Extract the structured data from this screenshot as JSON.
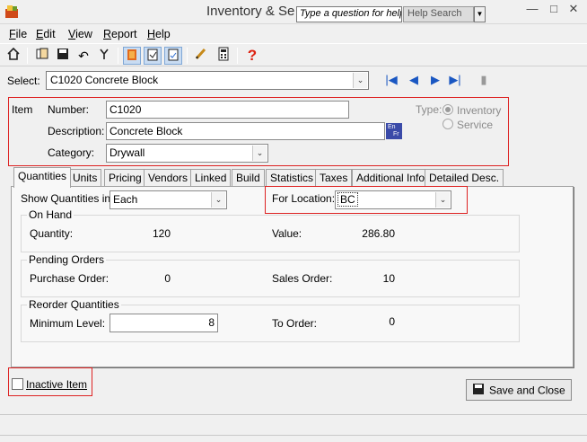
{
  "window": {
    "title": "Inventory & Se",
    "help_placeholder": "Type a question for help",
    "help_search_label": "Help Search"
  },
  "menu": [
    {
      "underline": "F",
      "rest": "ile"
    },
    {
      "underline": "E",
      "rest": "dit"
    },
    {
      "underline": "V",
      "rest": "iew"
    },
    {
      "underline": "R",
      "rest": "eport"
    },
    {
      "underline": "H",
      "rest": "elp"
    }
  ],
  "select": {
    "label": "Select:",
    "value": "C1020  Concrete Block"
  },
  "item": {
    "section_label": "Item",
    "number_label": "Number:",
    "number_value": "C1020",
    "description_label": "Description:",
    "description_value": "Concrete Block",
    "lang_badge_top": "En",
    "lang_badge_bottom": "Fr",
    "category_label": "Category:",
    "category_value": "Drywall",
    "type_label": "Type:",
    "type_inventory": "Inventory",
    "type_service": "Service"
  },
  "tabs": [
    "Quantities",
    "Units",
    "Pricing",
    "Vendors",
    "Linked",
    "Build",
    "Statistics",
    "Taxes",
    "Additional Info",
    "Detailed Desc."
  ],
  "quantities": {
    "show_in_label": "Show Quantities in:",
    "show_in_value": "Each",
    "location_label": "For Location:",
    "location_value": "BC",
    "on_hand_title": "On Hand",
    "quantity_label": "Quantity:",
    "quantity_value": "120",
    "value_label": "Value:",
    "value_value": "286.80",
    "pending_title": "Pending Orders",
    "purchase_order_label": "Purchase Order:",
    "purchase_order_value": "0",
    "sales_order_label": "Sales Order:",
    "sales_order_value": "10",
    "reorder_title": "Reorder Quantities",
    "min_level_label": "Minimum Level:",
    "min_level_value": "8",
    "to_order_label": "To Order:",
    "to_order_value": "0"
  },
  "inactive_label": "Inactive Item",
  "save_close_label": "Save and Close"
}
